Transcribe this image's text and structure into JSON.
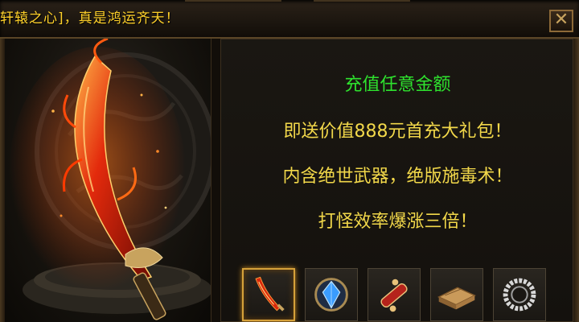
{
  "banner": {
    "marquee_text": "轩辕之心]，真是鸿运齐天！",
    "close_label": "✕"
  },
  "offer": {
    "headline": "充值任意金额",
    "lines": [
      "即送价值888元首充大礼包！",
      "内含绝世武器，绝版施毒术！",
      "打怪效率爆涨三倍！"
    ]
  },
  "reward_slots": [
    {
      "icon": "flame-sword-icon",
      "selected": true
    },
    {
      "icon": "blue-gem-icon",
      "selected": false
    },
    {
      "icon": "scroll-icon",
      "selected": false
    },
    {
      "icon": "book-icon",
      "selected": false
    },
    {
      "icon": "ring-icon",
      "selected": false
    }
  ],
  "colors": {
    "headline": "#2ee22e",
    "description": "#f2d84a",
    "marquee": "#ffd12a",
    "frame_gold": "#8d6a38"
  }
}
